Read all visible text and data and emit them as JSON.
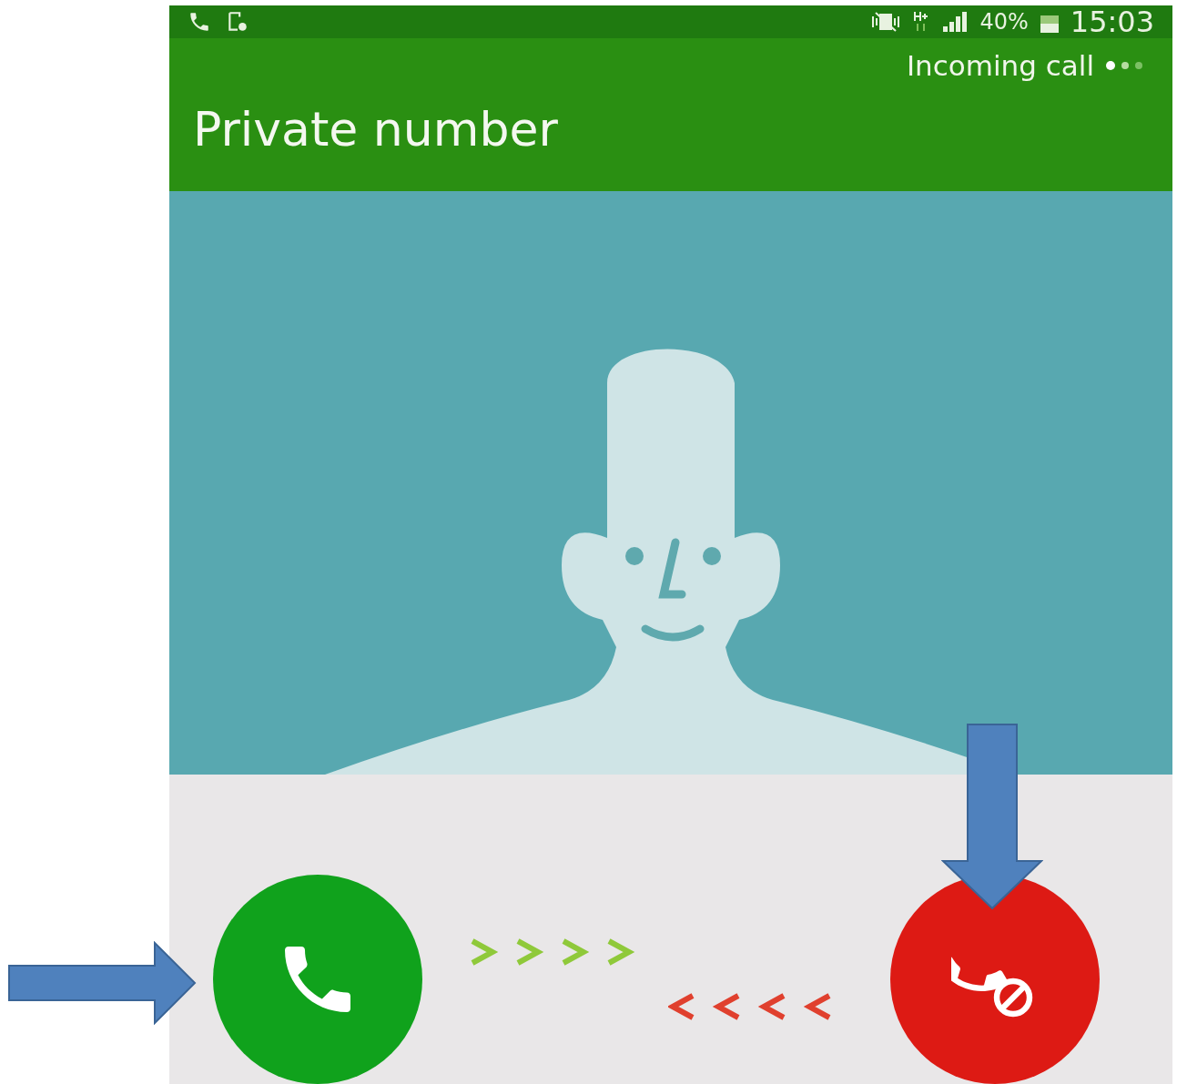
{
  "status_bar": {
    "battery": "40%",
    "time": "15:03"
  },
  "header": {
    "status": "Incoming call",
    "caller": "Private number"
  },
  "call_buttons": [
    {
      "kind": "accept"
    },
    {
      "kind": "decline"
    }
  ]
}
